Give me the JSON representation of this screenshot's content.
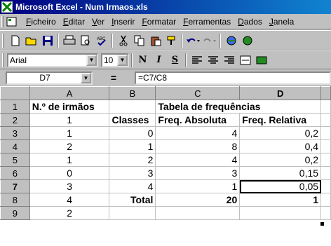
{
  "window": {
    "title": "Microsoft Excel - Num Irmaos.xls"
  },
  "menu": [
    "Ficheiro",
    "Editar",
    "Ver",
    "Inserir",
    "Formatar",
    "Ferramentas",
    "Dados",
    "Janela"
  ],
  "format_toolbar": {
    "font": "Arial",
    "size": "10",
    "bold": "N",
    "italic": "I",
    "underline": "S"
  },
  "formula_bar": {
    "cell_ref": "D7",
    "equals": "=",
    "formula": "=C7/C8"
  },
  "sheet": {
    "columns": [
      "A",
      "B",
      "C",
      "D"
    ],
    "rows": [
      {
        "num": "1",
        "cells": [
          "N.º de irmãos",
          "",
          "Tabela de frequências",
          ""
        ]
      },
      {
        "num": "2",
        "cells": [
          "1",
          "Classes",
          "Freq. Absoluta",
          "Freq. Relativa"
        ]
      },
      {
        "num": "3",
        "cells": [
          "1",
          "0",
          "4",
          "0,2"
        ]
      },
      {
        "num": "4",
        "cells": [
          "2",
          "1",
          "8",
          "0,4"
        ]
      },
      {
        "num": "5",
        "cells": [
          "1",
          "2",
          "4",
          "0,2"
        ]
      },
      {
        "num": "6",
        "cells": [
          "0",
          "3",
          "3",
          "0,15"
        ]
      },
      {
        "num": "7",
        "cells": [
          "3",
          "4",
          "1",
          "0,05"
        ]
      },
      {
        "num": "8",
        "cells": [
          "4",
          "Total",
          "20",
          "1"
        ]
      },
      {
        "num": "9",
        "cells": [
          "2",
          "",
          "",
          ""
        ]
      }
    ],
    "selected_cell": "D7"
  }
}
